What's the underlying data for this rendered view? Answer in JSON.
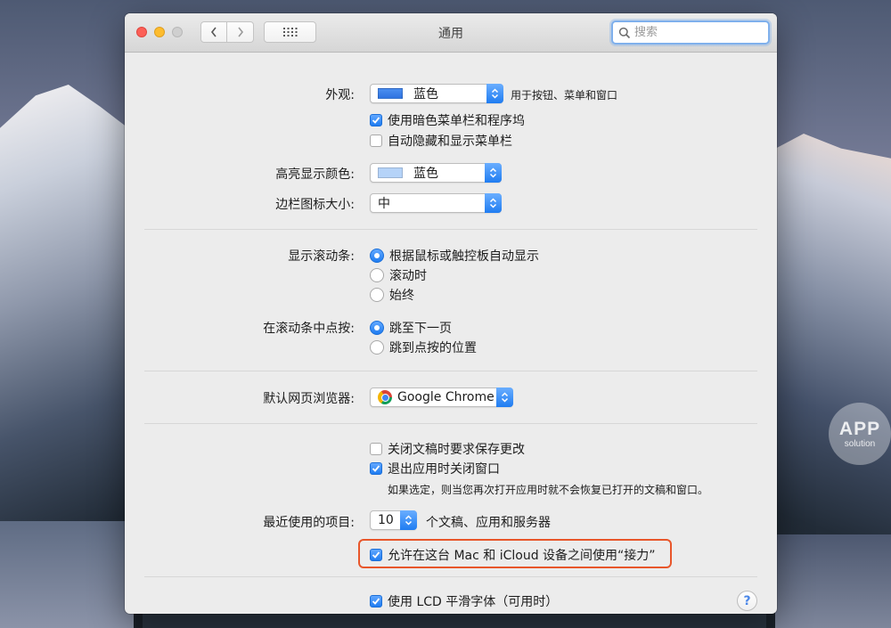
{
  "window": {
    "title": "通用",
    "search_placeholder": "搜索"
  },
  "appearance": {
    "label": "外观:",
    "value": "蓝色",
    "note": "用于按钮、菜单和窗口",
    "dark_menu": {
      "label": "使用暗色菜单栏和程序坞",
      "checked": true
    },
    "auto_hide_menu": {
      "label": "自动隐藏和显示菜单栏",
      "checked": false
    }
  },
  "highlight_color": {
    "label": "高亮显示颜色:",
    "value": "蓝色"
  },
  "sidebar_icon_size": {
    "label": "边栏图标大小:",
    "value": "中"
  },
  "show_scrollbars": {
    "label": "显示滚动条:",
    "options": [
      {
        "label": "根据鼠标或触控板自动显示",
        "selected": true
      },
      {
        "label": "滚动时",
        "selected": false
      },
      {
        "label": "始终",
        "selected": false
      }
    ]
  },
  "click_scrollbar": {
    "label": "在滚动条中点按:",
    "options": [
      {
        "label": "跳至下一页",
        "selected": true
      },
      {
        "label": "跳到点按的位置",
        "selected": false
      }
    ]
  },
  "default_browser": {
    "label": "默认网页浏览器:",
    "value": "Google Chrome"
  },
  "documents": {
    "ask_keep_changes": {
      "label": "关闭文稿时要求保存更改",
      "checked": false
    },
    "close_windows": {
      "label": "退出应用时关闭窗口",
      "checked": true
    },
    "hint": "如果选定，则当您再次打开应用时就不会恢复已打开的文稿和窗口。"
  },
  "recent_items": {
    "label": "最近使用的项目:",
    "value": "10",
    "suffix": "个文稿、应用和服务器"
  },
  "handoff": {
    "label": "允许在这台 Mac 和 iCloud 设备之间使用“接力”",
    "checked": true
  },
  "lcd_smoothing": {
    "label": "使用 LCD 平滑字体（可用时）",
    "checked": true
  },
  "help": {
    "label": "?"
  },
  "watermark": {
    "line1": "APP",
    "line2": "solution"
  },
  "colors": {
    "accent": "#1f7cf1",
    "highlight_frame": "#e8562a"
  }
}
